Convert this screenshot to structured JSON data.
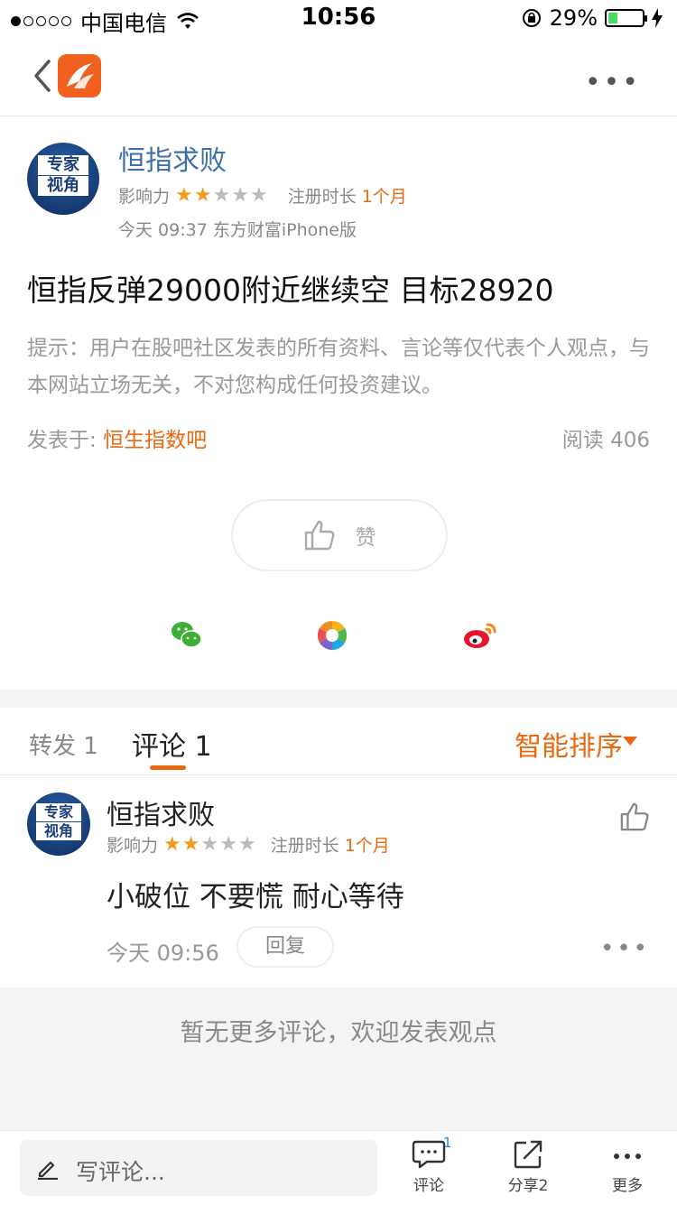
{
  "status_bar": {
    "carrier": "中国电信",
    "time": "10:56",
    "battery": "29%",
    "battery_level": 0.29
  },
  "post": {
    "author": {
      "name": "恒指求败",
      "avatar_text": [
        "专家",
        "视角"
      ],
      "influence_label": "影响力",
      "stars": 2,
      "stars_total": 5,
      "reg_label": "注册时长",
      "reg_value": "1个月"
    },
    "time_source": "今天 09:37 东方财富iPhone版",
    "title": "恒指反弹29000附近继续空 目标28920",
    "tip": "提示：用户在股吧社区发表的所有资料、言论等仅代表个人观点，与本网站立场无关，不对您构成任何投资建议。",
    "posted_label": "发表于:",
    "forum": "恒生指数吧",
    "reads": "阅读 406",
    "like_label": "赞"
  },
  "share_icons": [
    "wechat-icon",
    "moments-icon",
    "weibo-icon"
  ],
  "tabs": {
    "forward": "转发 1",
    "comments": "评论 1",
    "sort": "智能排序"
  },
  "comment": {
    "author": "恒指求败",
    "influence_label": "影响力",
    "stars": 2,
    "reg_label": "注册时长",
    "reg_value": "1个月",
    "text": "小破位 不要慌 耐心等待",
    "time": "今天 09:56",
    "reply_label": "回复"
  },
  "no_more": "暂无更多评论，欢迎发表观点",
  "bottom_bar": {
    "input_placeholder": "写评论...",
    "comment_label": "评论",
    "comment_badge": "1",
    "share_label": "分享2",
    "more_label": "更多"
  },
  "colors": {
    "accent": "#e8690f",
    "link": "#3d6fa8",
    "star": "#f39b1e"
  }
}
